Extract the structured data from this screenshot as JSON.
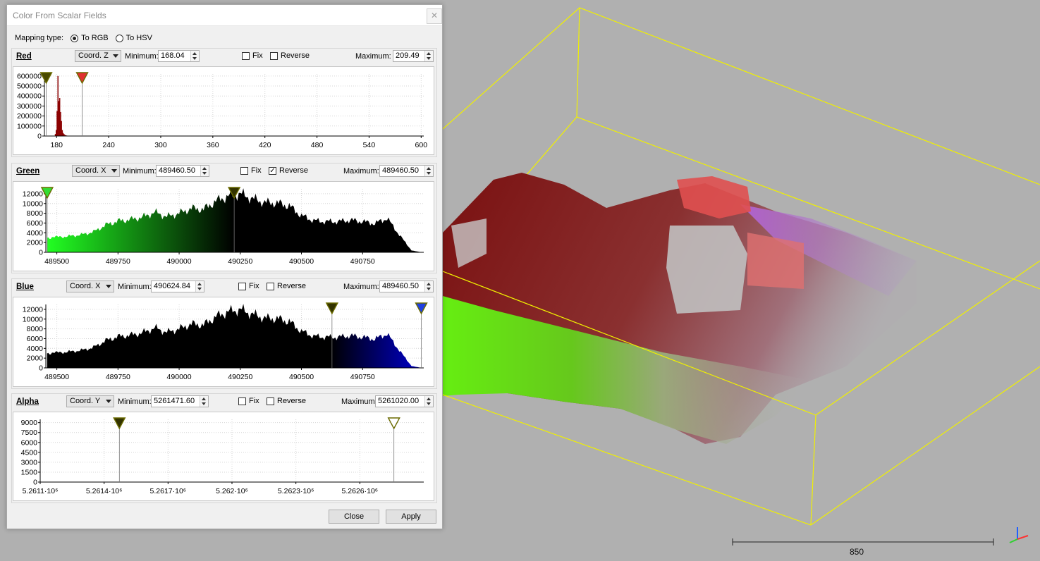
{
  "dialog": {
    "title": "Color From Scalar Fields",
    "close_icon": "close-icon",
    "mapping_label": "Mapping type:",
    "mapping_options": [
      "To RGB",
      "To HSV"
    ],
    "mapping_selected": "To RGB",
    "min_label": "Minimum:",
    "max_label": "Maximum:",
    "fix_label": "Fix",
    "reverse_label": "Reverse",
    "buttons": {
      "close": "Close",
      "apply": "Apply"
    }
  },
  "channels": {
    "red": {
      "name": "Red",
      "field": "Coord. Z",
      "minimum": "168.04",
      "maximum": "209.49",
      "fix": false,
      "reverse": false,
      "color": "#8b0000",
      "chart_data": {
        "type": "bar",
        "x_ticks": [
          "180",
          "240",
          "300",
          "360",
          "420",
          "480",
          "540",
          "600"
        ],
        "y_ticks": [
          "0",
          "100000",
          "200000",
          "300000",
          "400000",
          "500000",
          "600000"
        ],
        "ylim": [
          0,
          620000
        ],
        "xlim": [
          166,
          603
        ],
        "bins_x": [
          178,
          179,
          180,
          181,
          182,
          183,
          184,
          185,
          186,
          187,
          188,
          189,
          190,
          191,
          192
        ],
        "bins_y": [
          20000,
          60000,
          250000,
          600000,
          350000,
          380000,
          240000,
          150000,
          60000,
          30000,
          20000,
          10000,
          8000,
          5000,
          3000
        ],
        "markers": [
          168.04,
          209.49
        ]
      }
    },
    "green": {
      "name": "Green",
      "field": "Coord. X",
      "minimum": "489460.50",
      "maximum": "489460.50",
      "fix": false,
      "reverse": true,
      "color": "#00cc00",
      "chart_data": {
        "type": "area",
        "x_ticks": [
          "489500",
          "489750",
          "490000",
          "490250",
          "490500",
          "490750"
        ],
        "y_ticks": [
          "0",
          "2000",
          "4000",
          "6000",
          "8000",
          "10000",
          "12000"
        ],
        "ylim": [
          0,
          13000
        ],
        "xlim": [
          489455,
          491000
        ],
        "x": [
          489460,
          489500,
          489550,
          489600,
          489650,
          489700,
          489750,
          489800,
          489850,
          489900,
          489950,
          490000,
          490050,
          490100,
          490150,
          490200,
          490250,
          490300,
          490350,
          490400,
          490450,
          490500,
          490550,
          490600,
          490650,
          490700,
          490750,
          490800,
          490850,
          490900,
          490950,
          490990
        ],
        "y": [
          3000,
          3100,
          3300,
          3600,
          4200,
          5600,
          6400,
          6700,
          7200,
          8200,
          7300,
          8000,
          9000,
          8800,
          10500,
          11500,
          12000,
          11000,
          10200,
          10100,
          9500,
          7500,
          6500,
          6300,
          6300,
          6600,
          6300,
          5900,
          7000,
          3600,
          400,
          0
        ],
        "markers": [
          489460.5,
          490225
        ]
      }
    },
    "blue": {
      "name": "Blue",
      "field": "Coord. X",
      "minimum": "490624.84",
      "maximum": "489460.50",
      "fix": false,
      "reverse": false,
      "color": "#0000cc",
      "chart_data": {
        "type": "area",
        "x_ticks": [
          "489500",
          "489750",
          "490000",
          "490250",
          "490500",
          "490750"
        ],
        "y_ticks": [
          "0",
          "2000",
          "4000",
          "6000",
          "8000",
          "10000",
          "12000"
        ],
        "ylim": [
          0,
          13000
        ],
        "xlim": [
          489455,
          491000
        ],
        "x": [
          489460,
          489500,
          489550,
          489600,
          489650,
          489700,
          489750,
          489800,
          489850,
          489900,
          489950,
          490000,
          490050,
          490100,
          490150,
          490200,
          490250,
          490300,
          490350,
          490400,
          490450,
          490500,
          490550,
          490600,
          490650,
          490700,
          490750,
          490800,
          490850,
          490900,
          490950,
          490990
        ],
        "y": [
          3000,
          3100,
          3300,
          3600,
          4200,
          5600,
          6400,
          6700,
          7200,
          8200,
          7300,
          8000,
          9000,
          8800,
          10500,
          11500,
          12000,
          11000,
          10200,
          10100,
          9500,
          7500,
          6500,
          6300,
          6300,
          6600,
          6300,
          5900,
          7000,
          3600,
          400,
          0
        ],
        "markers": [
          490624.84,
          490990
        ]
      }
    },
    "alpha": {
      "name": "Alpha",
      "field": "Coord. Y",
      "minimum": "5261471.60",
      "maximum": "5261020.00",
      "fix": false,
      "reverse": false,
      "color": "#ffffff",
      "chart_data": {
        "type": "area",
        "x_ticks": [
          "5.2611·10⁶",
          "5.2614·10⁶",
          "5.2617·10⁶",
          "5.262·10⁶",
          "5.2623·10⁶",
          "5.2626·10⁶"
        ],
        "y_ticks": [
          "0",
          "1500",
          "3000",
          "4500",
          "6000",
          "7500",
          "9000"
        ],
        "ylim": [
          0,
          9500
        ],
        "xlim": [
          5261100,
          5262900
        ],
        "markers": [
          5261471.6,
          5262760
        ]
      }
    }
  },
  "viewport": {
    "scale_label": "850",
    "axis_icon": "axis-trihedron-icon"
  }
}
